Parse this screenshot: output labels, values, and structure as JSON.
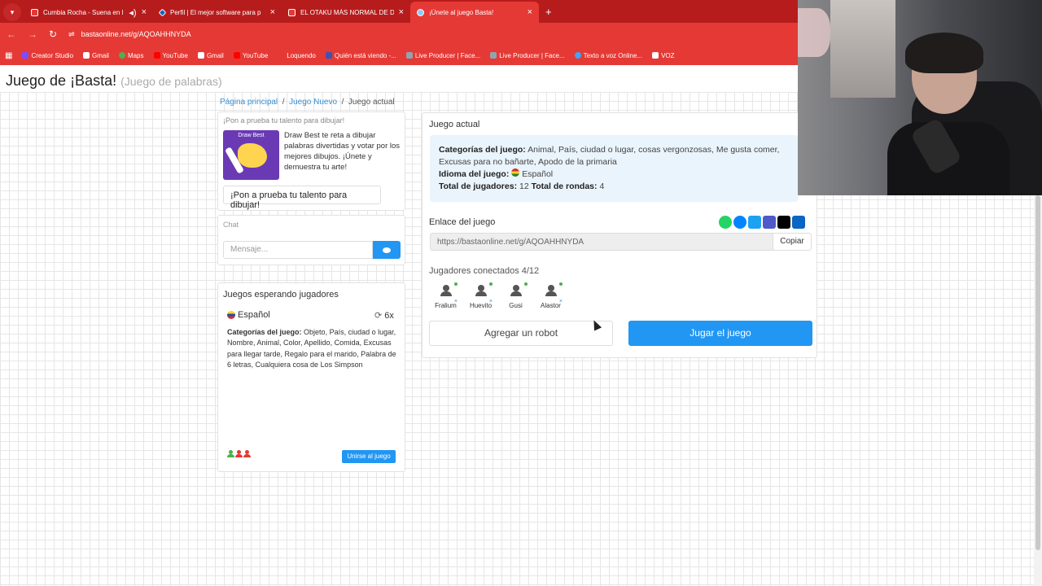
{
  "browser": {
    "tabs": [
      {
        "title": "Cumbia Rocha - Suena en l",
        "icon": "youtube-icon"
      },
      {
        "title": "Perfil | El mejor software para p",
        "icon": "diamond-icon"
      },
      {
        "title": "EL OTAKU MÁS NORMAL DE D",
        "icon": "youtube-icon"
      },
      {
        "title": "¡Únete al juego Basta!",
        "icon": "globe-icon"
      }
    ],
    "url": "bastaonline.net/g/AQOAHHNYDA",
    "bookmarks": [
      {
        "label": "Creator Studio",
        "color": "#7c4dff"
      },
      {
        "label": "Gmail",
        "color": "#ffffff"
      },
      {
        "label": "Maps",
        "color": "#4caf50"
      },
      {
        "label": "YouTube",
        "color": "#ff0000"
      },
      {
        "label": "Gmail",
        "color": "#ffffff"
      },
      {
        "label": "YouTube",
        "color": "#ff0000"
      },
      {
        "label": "Loquendo",
        "color": "#e53935"
      },
      {
        "label": "Quién está viendo -...",
        "color": "#3f51b5"
      },
      {
        "label": "Live Producer | Face...",
        "color": "#90a4ae"
      },
      {
        "label": "Live Producer | Face...",
        "color": "#90a4ae"
      },
      {
        "label": "Texto a voz Online...",
        "color": "#42a5f5"
      },
      {
        "label": "VOZ",
        "color": "#ffffff"
      }
    ]
  },
  "header": {
    "title": "Juego de ¡Basta!",
    "subtitle": "(Juego de palabras)"
  },
  "breadcrumb": {
    "home": "Página principal",
    "new": "Juego Nuevo",
    "current": "Juego actual"
  },
  "promo": {
    "title": "¡Pon a prueba tu talento para dibujar!",
    "image_text": "Draw Best",
    "text": "Draw Best te reta a dibujar palabras divertidas y votar por los mejores dibujos. ¡Únete y demuestra tu arte!",
    "button": "¡Pon a prueba tu talento para dibujar!"
  },
  "chat": {
    "title": "Chat",
    "placeholder": "Mensaje..."
  },
  "waiting": {
    "title": "Juegos esperando jugadores",
    "language": "Español",
    "rounds": "6x",
    "categories_label": "Categorías del juego:",
    "categories": "Objeto, País, ciudad o lugar, Nombre, Animal, Color, Apellido, Comida, Excusas para llegar tarde, Regalo para el marido, Palabra de 6 letras, Cualquiera cosa de Los Simpson",
    "players": [
      {
        "color": "#4caf50"
      },
      {
        "color": "#e53935"
      },
      {
        "color": "#e53935"
      }
    ],
    "join": "Unirse al juego"
  },
  "game": {
    "title": "Juego actual",
    "categories_label": "Categorías del juego:",
    "categories": "Animal, País, ciudad o lugar, cosas vergonzosas, Me gusta comer, Excusas para no bañarte, Apodo de la primaria",
    "language_label": "Idioma del juego:",
    "language": "Español",
    "players_label": "Total de jugadores:",
    "players_total": "12",
    "rounds_label": "Total de rondas:",
    "rounds_total": "4",
    "link_title": "Enlace del juego",
    "link": "https://bastaonline.net/g/AQOAHHNYDA",
    "copy": "Copiar",
    "share_colors": [
      "#25d366",
      "#0084ff",
      "#1da1f2",
      "#5059c9",
      "#000000",
      "#0a66c2"
    ],
    "connected_title": "Jugadores conectados 4/12",
    "players": [
      "Fralium",
      "Huevito",
      "Gusi",
      "Alastor"
    ],
    "add_robot": "Agregar un robot",
    "play": "Jugar el juego"
  }
}
